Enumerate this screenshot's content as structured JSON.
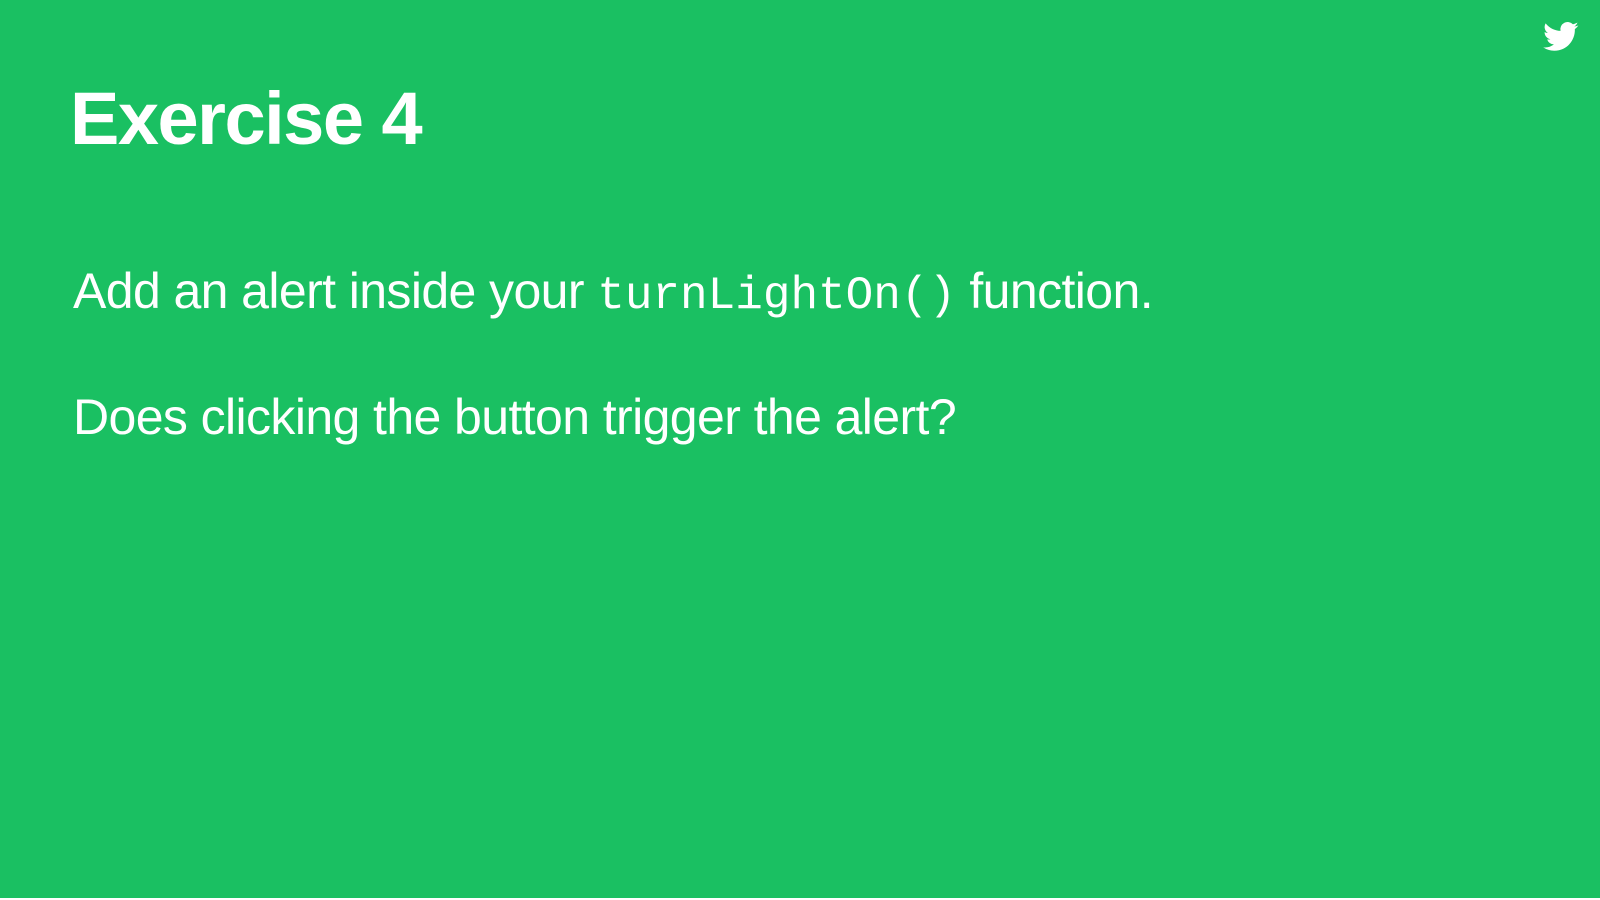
{
  "slide": {
    "background_color": "#1ac062",
    "text_color": "#ffffff",
    "corner_icon": "twitter-bird-icon",
    "title": "Exercise 4",
    "body": {
      "line1": {
        "before": "Add an alert inside your ",
        "code": "turnLightOn()",
        "after": " function."
      },
      "line2": "Does clicking the button trigger the alert?"
    }
  }
}
